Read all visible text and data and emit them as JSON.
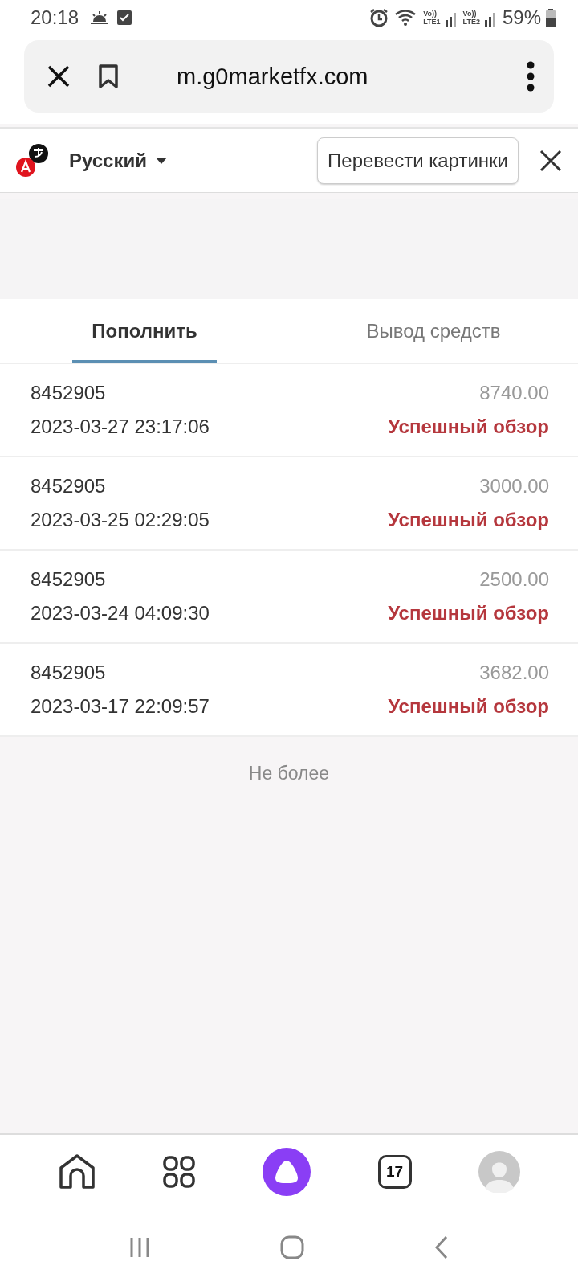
{
  "status_bar": {
    "time": "20:18",
    "sims": [
      {
        "volte": "Vo))",
        "label": "LTE1"
      },
      {
        "volte": "Vo))",
        "label": "LTE2"
      }
    ],
    "battery": "59%"
  },
  "address_bar": {
    "url": "m.g0marketfx.com"
  },
  "translate_bar": {
    "language": "Русский",
    "button": "Перевести картинки"
  },
  "tabs": [
    {
      "label": "Пополнить",
      "selected": true
    },
    {
      "label": "Вывод средств",
      "selected": false
    }
  ],
  "rows": [
    {
      "account": "8452905",
      "datetime": "2023-03-27 23:17:06",
      "amount": "8740.00",
      "status": "Успешный обзор"
    },
    {
      "account": "8452905",
      "datetime": "2023-03-25 02:29:05",
      "amount": "3000.00",
      "status": "Успешный обзор"
    },
    {
      "account": "8452905",
      "datetime": "2023-03-24 04:09:30",
      "amount": "2500.00",
      "status": "Успешный обзор"
    },
    {
      "account": "8452905",
      "datetime": "2023-03-17 22:09:57",
      "amount": "3682.00",
      "status": "Успешный обзор"
    }
  ],
  "footer": "Не более",
  "bottom_nav": {
    "calendar_day": "17"
  }
}
